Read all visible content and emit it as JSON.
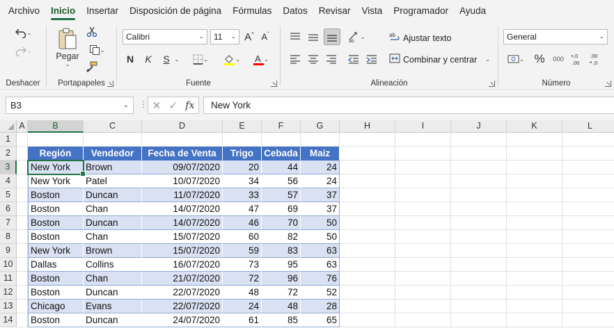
{
  "menu": {
    "tabs": [
      "Archivo",
      "Inicio",
      "Insertar",
      "Disposición de página",
      "Fórmulas",
      "Datos",
      "Revisar",
      "Vista",
      "Programador",
      "Ayuda"
    ],
    "active": "Inicio"
  },
  "ribbon": {
    "undo_group": "Deshacer",
    "clipboard_group": "Portapapeles",
    "paste_label": "Pegar",
    "font_group": "Fuente",
    "font_name": "Calibri",
    "font_size": "11",
    "bold": "N",
    "italic": "K",
    "underline": "S",
    "alignment_group": "Alineación",
    "wrap_text": "Ajustar texto",
    "merge_center": "Combinar y centrar",
    "number_group": "Número",
    "number_format": "General",
    "percent": "%",
    "thousands": "000",
    "dec_inc": ",0 ,00",
    "dec_dec": ",00 ,0",
    "font_color_accent": "#ff0000",
    "highlight_accent": "#ffff00"
  },
  "formula_bar": {
    "name_box": "B3",
    "fx": "fx",
    "value": "New York"
  },
  "grid": {
    "columns": [
      "A",
      "B",
      "C",
      "D",
      "E",
      "F",
      "G",
      "H",
      "I",
      "J",
      "K",
      "L"
    ],
    "selected_column": "B",
    "selected_row": "3",
    "rows": [
      "1",
      "2",
      "3",
      "4",
      "5",
      "6",
      "7",
      "8",
      "9",
      "10",
      "11",
      "12",
      "13",
      "14"
    ],
    "headers": [
      "Región",
      "Vendedor",
      "Fecha de Venta",
      "Trigo",
      "Cebada",
      "Maiz"
    ],
    "records": [
      [
        "New York",
        "Brown",
        "09/07/2020",
        "20",
        "44",
        "24"
      ],
      [
        "New York",
        "Patel",
        "10/07/2020",
        "34",
        "56",
        "24"
      ],
      [
        "Boston",
        "Duncan",
        "11/07/2020",
        "33",
        "57",
        "37"
      ],
      [
        "Boston",
        "Chan",
        "14/07/2020",
        "47",
        "69",
        "37"
      ],
      [
        "Boston",
        "Duncan",
        "14/07/2020",
        "46",
        "70",
        "50"
      ],
      [
        "Boston",
        "Chan",
        "15/07/2020",
        "60",
        "82",
        "50"
      ],
      [
        "New York",
        "Brown",
        "15/07/2020",
        "59",
        "83",
        "63"
      ],
      [
        "Dallas",
        "Collins",
        "16/07/2020",
        "73",
        "95",
        "63"
      ],
      [
        "Boston",
        "Chan",
        "21/07/2020",
        "72",
        "96",
        "76"
      ],
      [
        "Boston",
        "Duncan",
        "22/07/2020",
        "48",
        "72",
        "52"
      ],
      [
        "Chicago",
        "Evans",
        "22/07/2020",
        "24",
        "48",
        "28"
      ],
      [
        "Boston",
        "Duncan",
        "24/07/2020",
        "61",
        "85",
        "65"
      ]
    ],
    "table_header_color": "#4472c4",
    "table_band_color": "#d9e1f2",
    "selection_color": "#217346"
  }
}
